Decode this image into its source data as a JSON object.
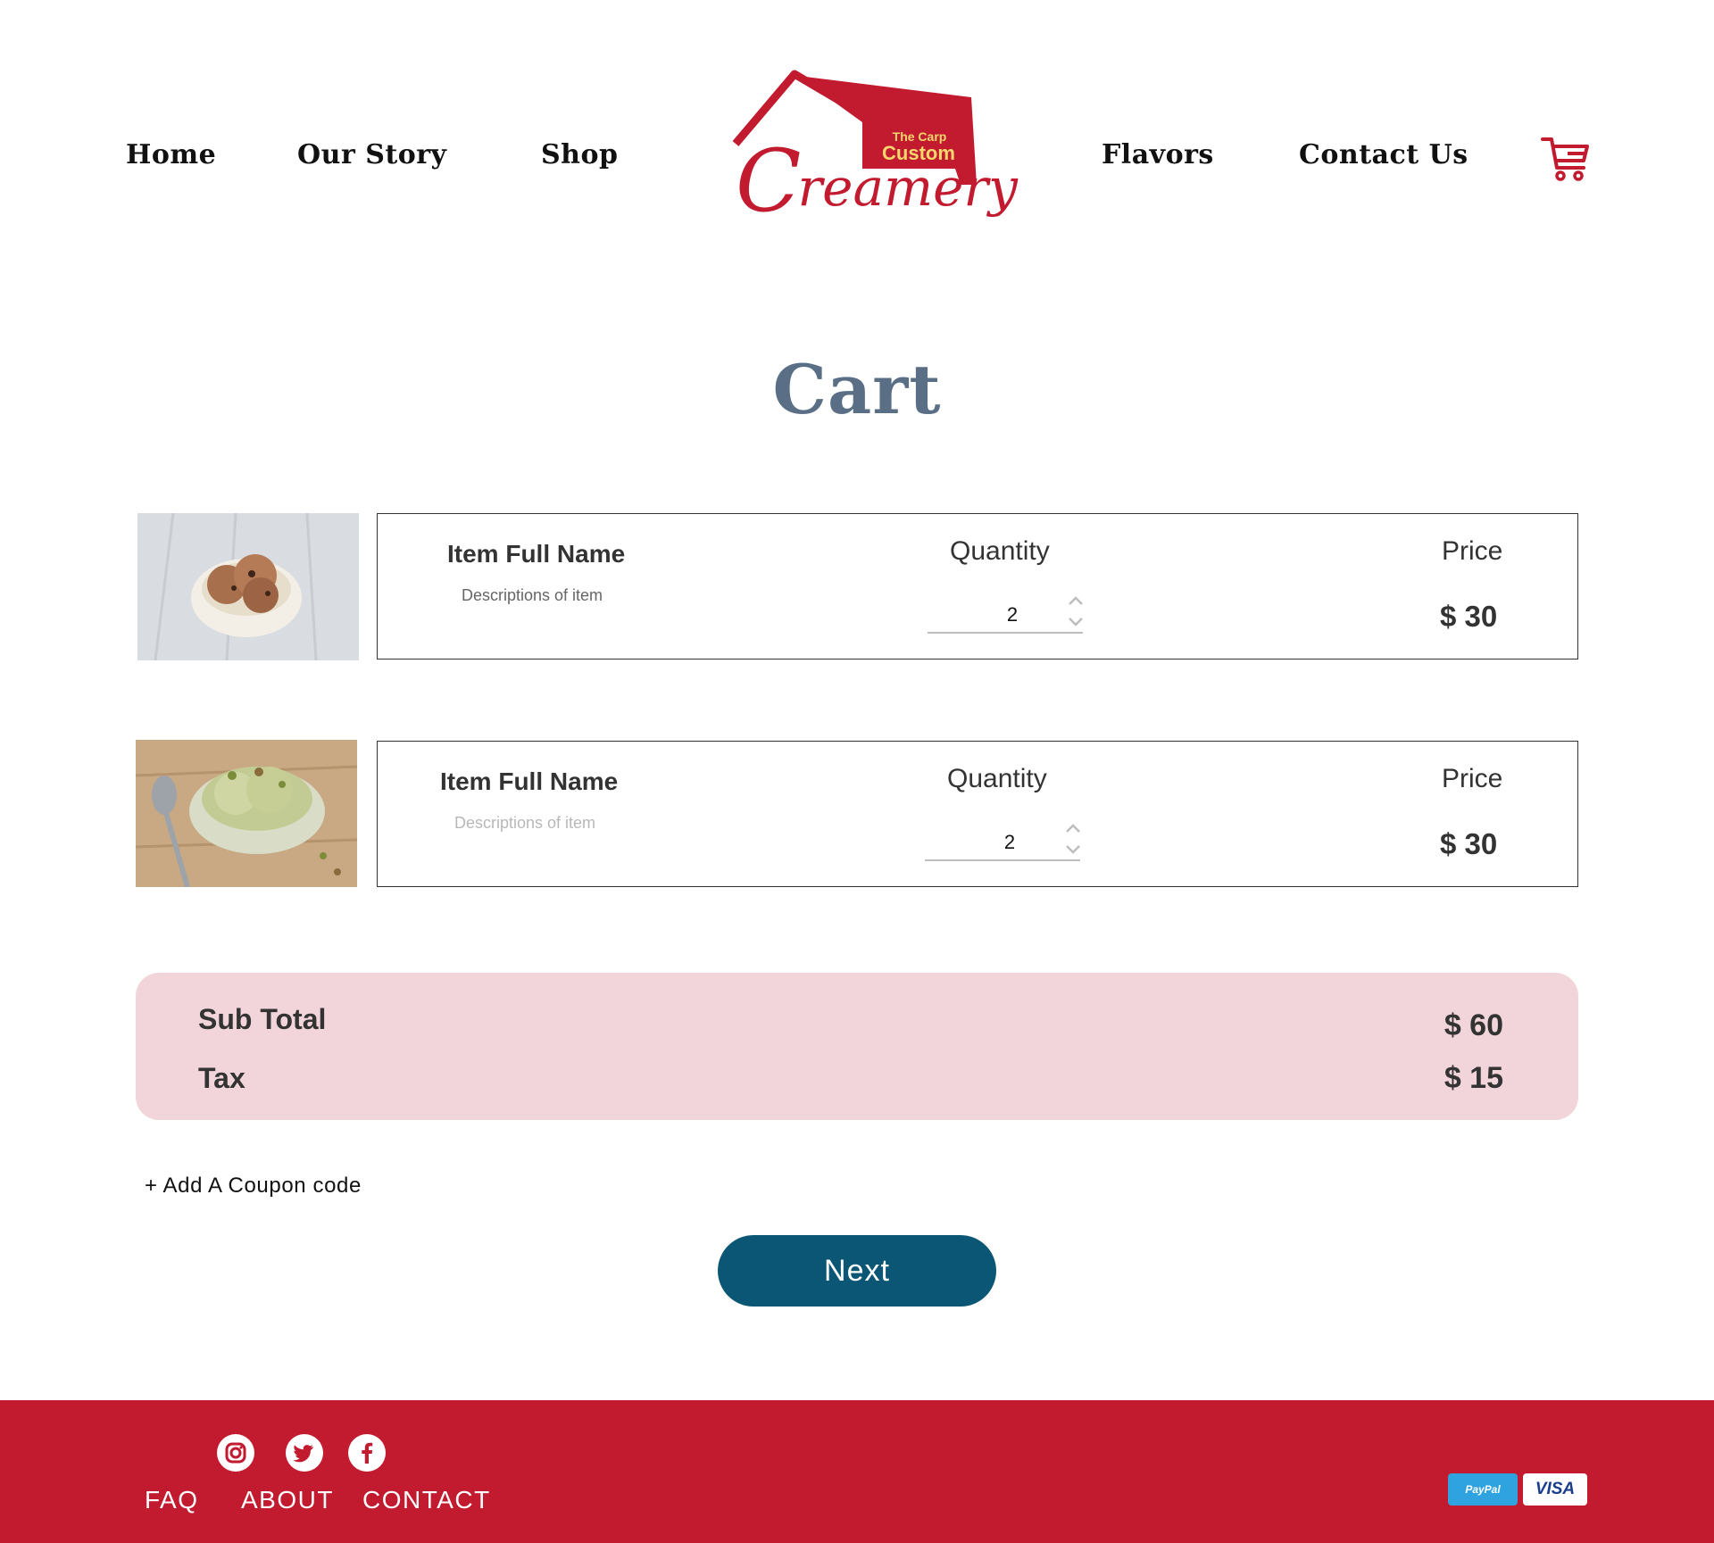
{
  "header": {
    "nav_left": [
      "Home",
      "Our Story",
      "Shop"
    ],
    "nav_right": [
      "Flavors",
      "Contact Us"
    ],
    "logo": {
      "small": "The Carp",
      "big": "Custom",
      "word_cap": "C",
      "word_rest": "reamery"
    },
    "cart_icon": "shopping-cart-icon"
  },
  "page": {
    "title": "Cart"
  },
  "cart": {
    "items": [
      {
        "name": "Item Full Name",
        "description": "Descriptions of item",
        "quantity_label": "Quantity",
        "quantity": "2",
        "price_label": "Price",
        "price": "$ 30",
        "image": "chocolate-chip-ice-cream-bowl"
      },
      {
        "name": "Item Full Name",
        "description": "Descriptions of item",
        "quantity_label": "Quantity",
        "quantity": "2",
        "price_label": "Price",
        "price": "$ 30",
        "image": "pistachio-ice-cream-bowl"
      }
    ]
  },
  "totals": {
    "subtotal_label": "Sub Total",
    "subtotal": "$ 60",
    "tax_label": "Tax",
    "tax": "$ 15"
  },
  "coupon": {
    "label": "+ Add A Coupon code"
  },
  "actions": {
    "next_label": "Next"
  },
  "footer": {
    "social": [
      "instagram-icon",
      "twitter-icon",
      "facebook-icon"
    ],
    "links": [
      "FAQ",
      "ABOUT",
      "CONTACT"
    ],
    "payments": {
      "paypal": "PayPal",
      "visa": "VISA"
    }
  },
  "colors": {
    "brand_red": "#c21b2f",
    "title_slate": "#5a6f86",
    "next_blue": "#0c5675",
    "totals_pink": "#f2d5da",
    "logo_yellow": "#f5d76e"
  }
}
